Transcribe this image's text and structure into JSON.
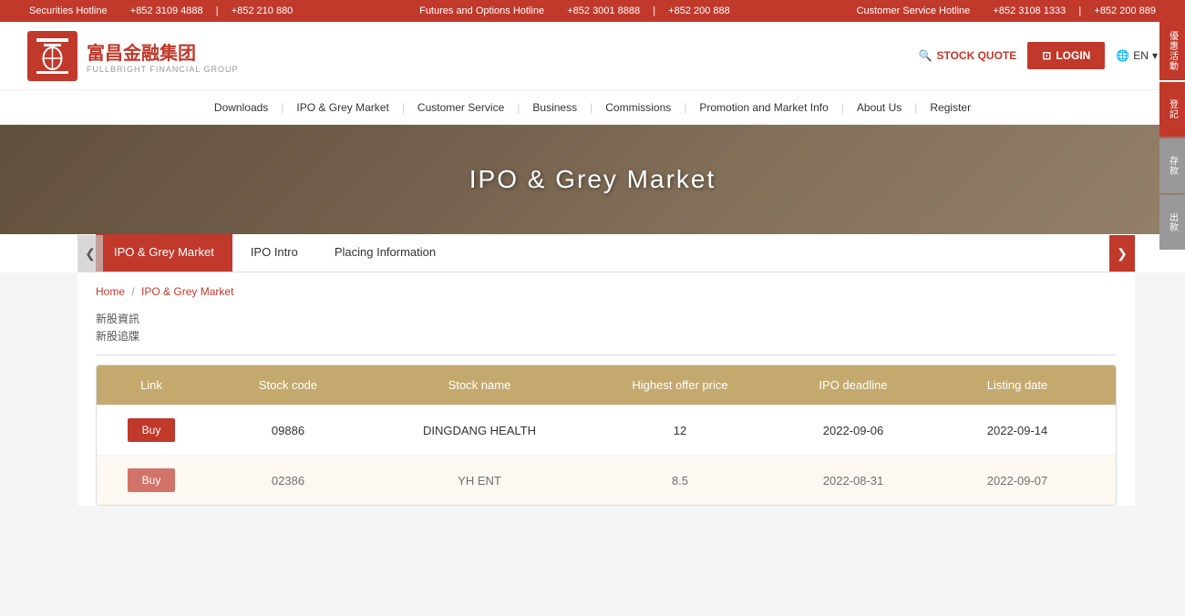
{
  "ticker": {
    "securities_label": "Securities Hotline",
    "securities_phone1": "+852 3109 4888",
    "securities_phone2": "+852 210 880",
    "futures_label": "Futures and Options Hotline",
    "futures_phone1": "+852 3001 8888",
    "futures_phone2": "+852 200 888",
    "customer_label": "Customer Service Hotline",
    "customer_phone1": "+852 3108 1333",
    "customer_phone2": "+852 200 889"
  },
  "logo": {
    "chinese": "富昌金融集团",
    "english": "FULLBRIGHT FINANCIAL GROUP"
  },
  "header": {
    "stock_quote": "STOCK QUOTE",
    "login": "LOGIN",
    "lang": "EN"
  },
  "nav": {
    "items": [
      "Downloads",
      "IPO & Grey Market",
      "Customer Service",
      "Business",
      "Commissions",
      "Promotion and Market Info",
      "About Us",
      "Register"
    ]
  },
  "hero": {
    "title": "IPO & Grey Market"
  },
  "tabs": [
    {
      "label": "IPO & Grey Market",
      "active": true
    },
    {
      "label": "IPO Intro",
      "active": false
    },
    {
      "label": "Placing Information",
      "active": false
    }
  ],
  "breadcrumb": {
    "home": "Home",
    "separator": "/",
    "current": "IPO & Grey Market"
  },
  "sub_nav": {
    "item1": "新股資訊",
    "item2": "新股追牒"
  },
  "table": {
    "headers": [
      "Link",
      "Stock code",
      "Stock name",
      "Highest offer price",
      "IPO deadline",
      "Listing date"
    ],
    "rows": [
      {
        "buy_label": "Buy",
        "stock_code": "09886",
        "stock_name": "DINGDANG HEALTH",
        "highest_offer_price": "12",
        "ipo_deadline": "2022-09-06",
        "listing_date": "2022-09-14"
      },
      {
        "buy_label": "Buy",
        "stock_code": "02386",
        "stock_name": "YH ENT",
        "highest_offer_price": "8.5",
        "ipo_deadline": "2022-08-31",
        "listing_date": "2022-09-07"
      }
    ]
  },
  "sidebar_right": {
    "items": [
      "優惠活動",
      "登記",
      "存款",
      "出款"
    ]
  },
  "arrows": {
    "left": "❮",
    "right": "❯"
  }
}
